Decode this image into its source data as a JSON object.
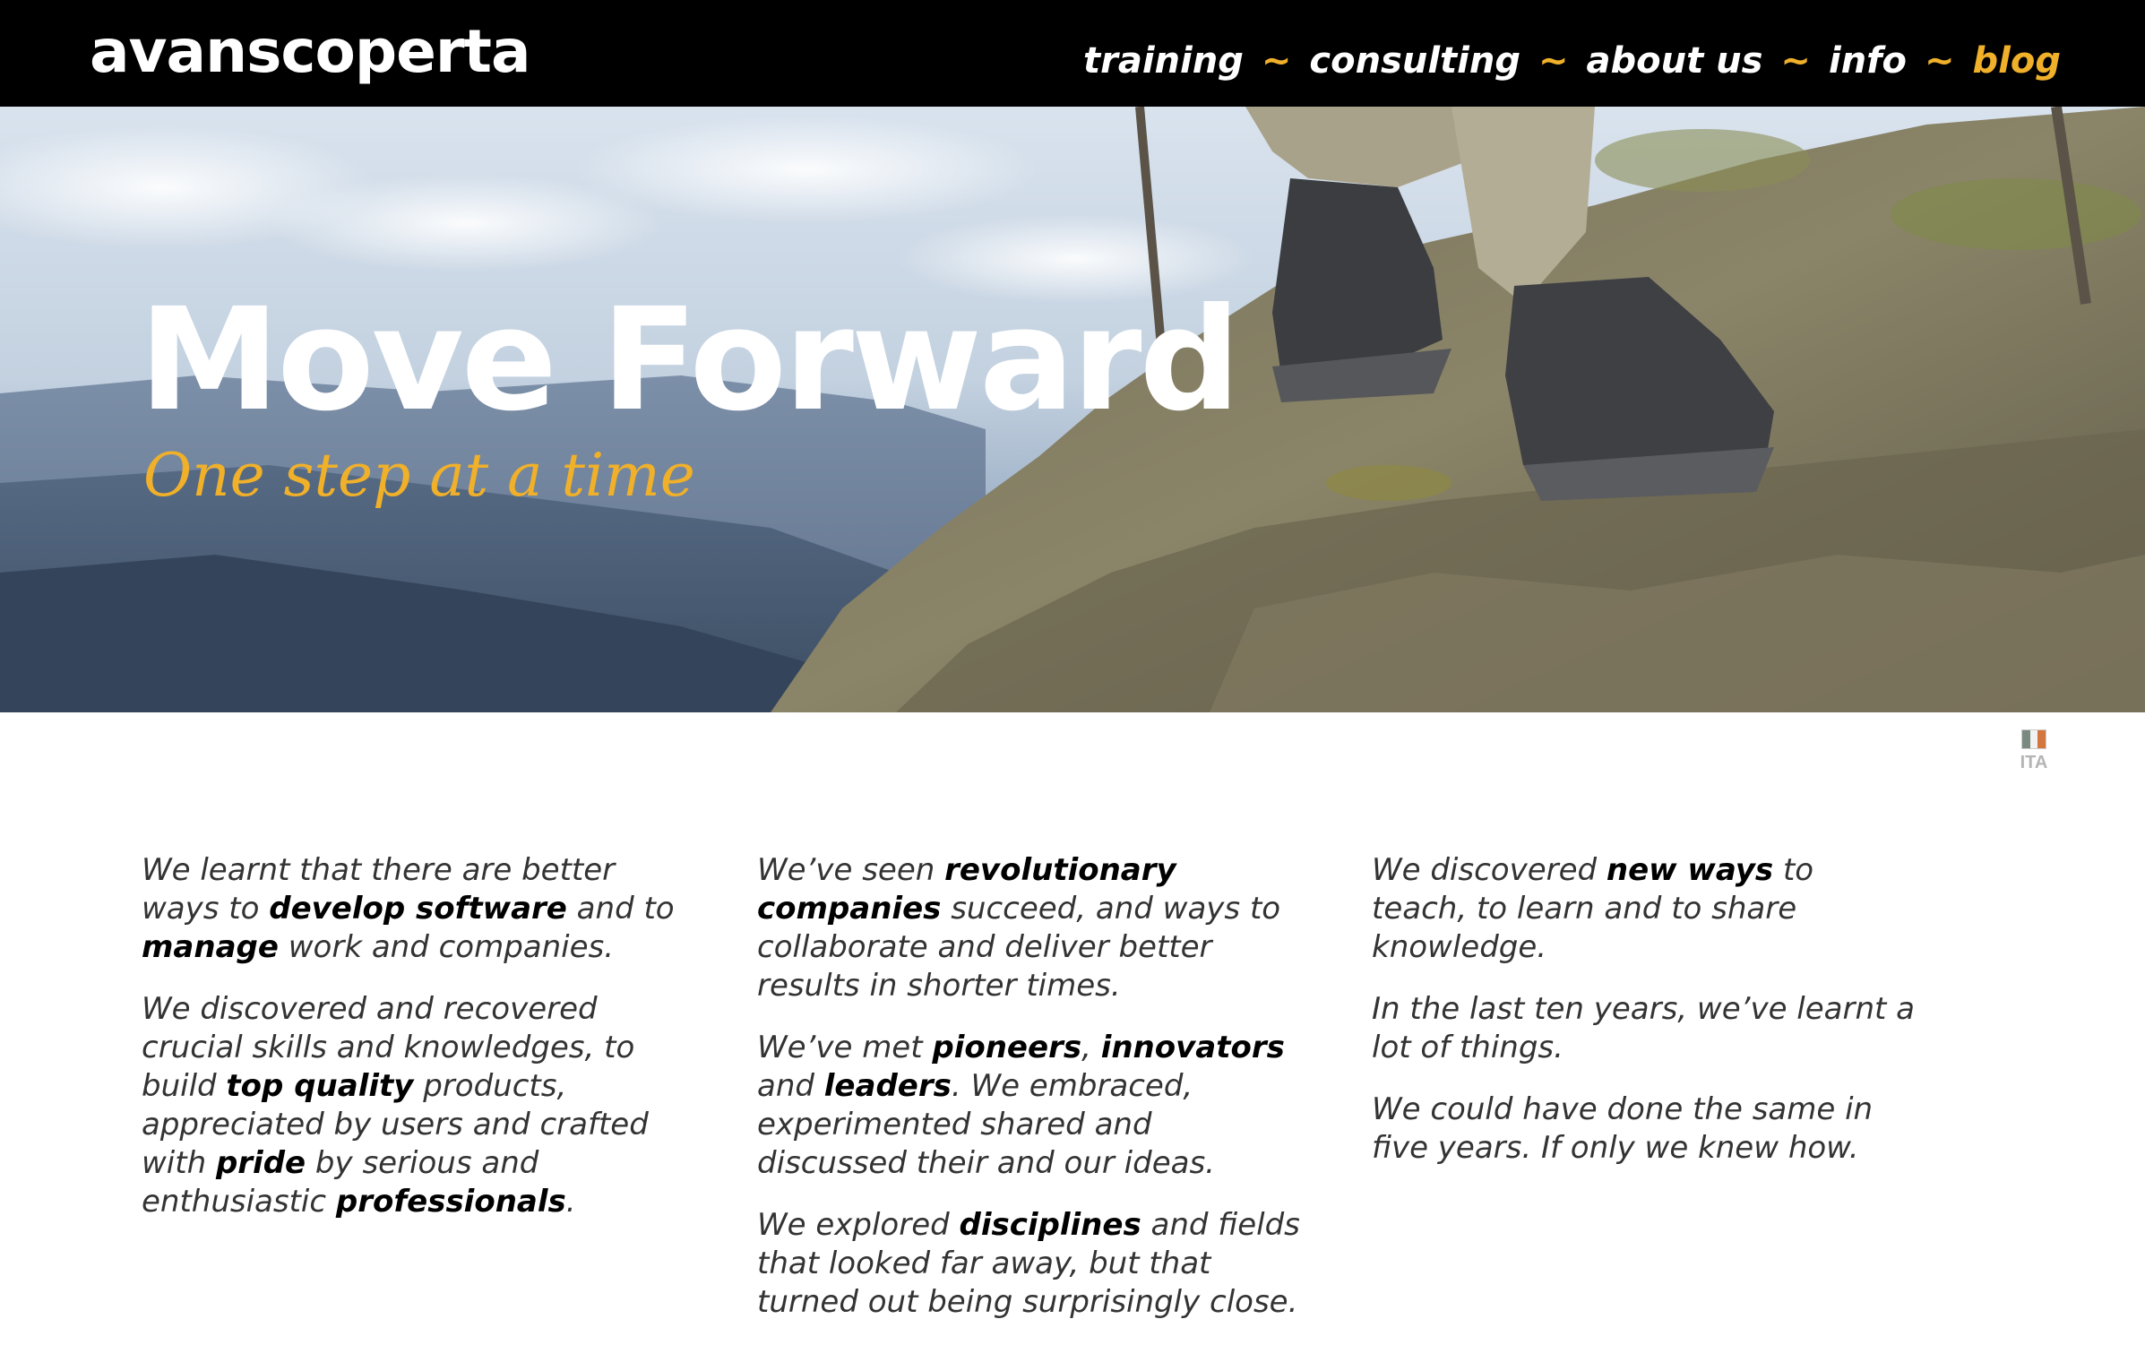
{
  "header": {
    "logo": "avanscoperta",
    "nav": {
      "training": "training",
      "consulting": "consulting",
      "about": "about us",
      "info": "info",
      "blog": "blog",
      "separator": "~"
    }
  },
  "hero": {
    "title": "Move Forward",
    "subtitle": "One step at a time"
  },
  "lang": {
    "label": "ITA"
  },
  "colors": {
    "accent": "#f0b02a",
    "header_bg": "#000000",
    "text": "#333333"
  },
  "col1": {
    "p1": {
      "a": "We learnt that there are better ways to ",
      "b": "develop software",
      "c": " and to ",
      "d": "manage",
      "e": " work and companies."
    },
    "p2": {
      "a": "We discovered and recovered crucial skills and knowledges, to build ",
      "b": "top quality",
      "c": " products, appreciated by users and crafted with ",
      "d": "pride",
      "e": " by serious and enthusiastic ",
      "f": "professionals",
      "g": "."
    }
  },
  "col2": {
    "p1": {
      "a": "We’ve seen ",
      "b": "revolutionary companies",
      "c": " succeed, and ways to collaborate and deliver better results in shorter times."
    },
    "p2": {
      "a": "We’ve met ",
      "b": "pioneers",
      "c": ", ",
      "d": "innovators",
      "e": " and ",
      "f": "leaders",
      "g": ". We embraced, experimented shared and discussed their and our ideas."
    },
    "p3": {
      "a": "We explored ",
      "b": "disciplines",
      "c": " and fields that looked far away, but that turned out being surprisingly close."
    }
  },
  "col3": {
    "p1": {
      "a": "We discovered ",
      "b": "new ways",
      "c": " to teach, to learn and to share knowledge."
    },
    "p2": "In the last ten years, we’ve learnt a lot of things.",
    "p3": "We could have done the same in five years. If only we knew how."
  }
}
